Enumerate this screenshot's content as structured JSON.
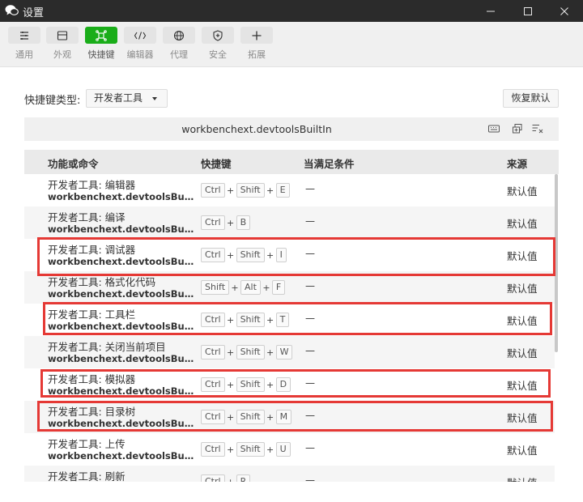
{
  "window": {
    "title": "设置",
    "controls": [
      "minimize-icon",
      "maximize-icon",
      "close-icon"
    ]
  },
  "toolbar": {
    "items": [
      {
        "label": "通用",
        "icon": "list-settings-icon",
        "active": false
      },
      {
        "label": "外观",
        "icon": "layout-icon",
        "active": false
      },
      {
        "label": "快捷键",
        "icon": "shortcut-icon",
        "active": true
      },
      {
        "label": "编辑器",
        "icon": "code-icon",
        "active": false
      },
      {
        "label": "代理",
        "icon": "globe-icon",
        "active": false
      },
      {
        "label": "安全",
        "icon": "shield-icon",
        "active": false
      },
      {
        "label": "拓展",
        "icon": "plus-icon",
        "active": false
      }
    ]
  },
  "shortcut_type": {
    "label": "快捷键类型:",
    "selected": "开发者工具"
  },
  "reset_button": "恢复默认",
  "search": {
    "query": "workbenchext.devtoolsBuiltIn",
    "icons": [
      "keyboard-icon",
      "copy-icon",
      "clear-filter-icon"
    ]
  },
  "table": {
    "headers": {
      "command": "功能或命令",
      "keybinding": "快捷键",
      "when": "当满足条件",
      "source": "来源"
    },
    "rows": [
      {
        "name": "开发者工具: 编辑器",
        "id": "workbenchext.devtoolsBuiltIn.toggleEditor",
        "keys": [
          "Ctrl",
          "Shift",
          "E"
        ],
        "when": "—",
        "source": "默认值",
        "highlighted": false
      },
      {
        "name": "开发者工具: 编译",
        "id": "workbenchext.devtoolsBuiltIn.run",
        "keys": [
          "Ctrl",
          "B"
        ],
        "when": "—",
        "source": "默认值",
        "highlighted": false
      },
      {
        "name": "开发者工具: 调试器",
        "id": "workbenchext.devtoolsBuiltIn.toggleDebugger",
        "keys": [
          "Ctrl",
          "Shift",
          "I"
        ],
        "when": "—",
        "source": "默认值",
        "highlighted": true
      },
      {
        "name": "开发者工具: 格式化代码",
        "id": "workbenchext.devtoolsBuiltIn.format",
        "keys": [
          "Shift",
          "Alt",
          "F"
        ],
        "when": "—",
        "source": "默认值",
        "highlighted": false
      },
      {
        "name": "开发者工具: 工具栏",
        "id": "workbenchext.devtoolsBuiltIn.toggleToolbar",
        "keys": [
          "Ctrl",
          "Shift",
          "T"
        ],
        "when": "—",
        "source": "默认值",
        "highlighted": true
      },
      {
        "name": "开发者工具: 关闭当前项目",
        "id": "workbenchext.devtoolsBuiltIn.closeProject",
        "keys": [
          "Ctrl",
          "Shift",
          "W"
        ],
        "when": "—",
        "source": "默认值",
        "highlighted": false
      },
      {
        "name": "开发者工具: 模拟器",
        "id": "workbenchext.devtoolsBuiltIn.toggleSimulator",
        "keys": [
          "Ctrl",
          "Shift",
          "D"
        ],
        "when": "—",
        "source": "默认值",
        "highlighted": true
      },
      {
        "name": "开发者工具: 目录树",
        "id": "workbenchext.devtoolsBuiltIn.toggleTree",
        "keys": [
          "Ctrl",
          "Shift",
          "M"
        ],
        "when": "—",
        "source": "默认值",
        "highlighted": true
      },
      {
        "name": "开发者工具: 上传",
        "id": "workbenchext.devtoolsBuiltIn.upload",
        "keys": [
          "Ctrl",
          "Shift",
          "U"
        ],
        "when": "—",
        "source": "默认值",
        "highlighted": false
      },
      {
        "name": "开发者工具: 刷新",
        "id": "workbenchext.devtoolsBuiltIn.refresh",
        "keys": [
          "Ctrl",
          "R"
        ],
        "when": "—",
        "source": "默认值",
        "highlighted": false
      }
    ]
  },
  "colors": {
    "titlebar": "#2b2b2b",
    "accent_green": "#1aad19",
    "highlight_red": "#e53935"
  }
}
